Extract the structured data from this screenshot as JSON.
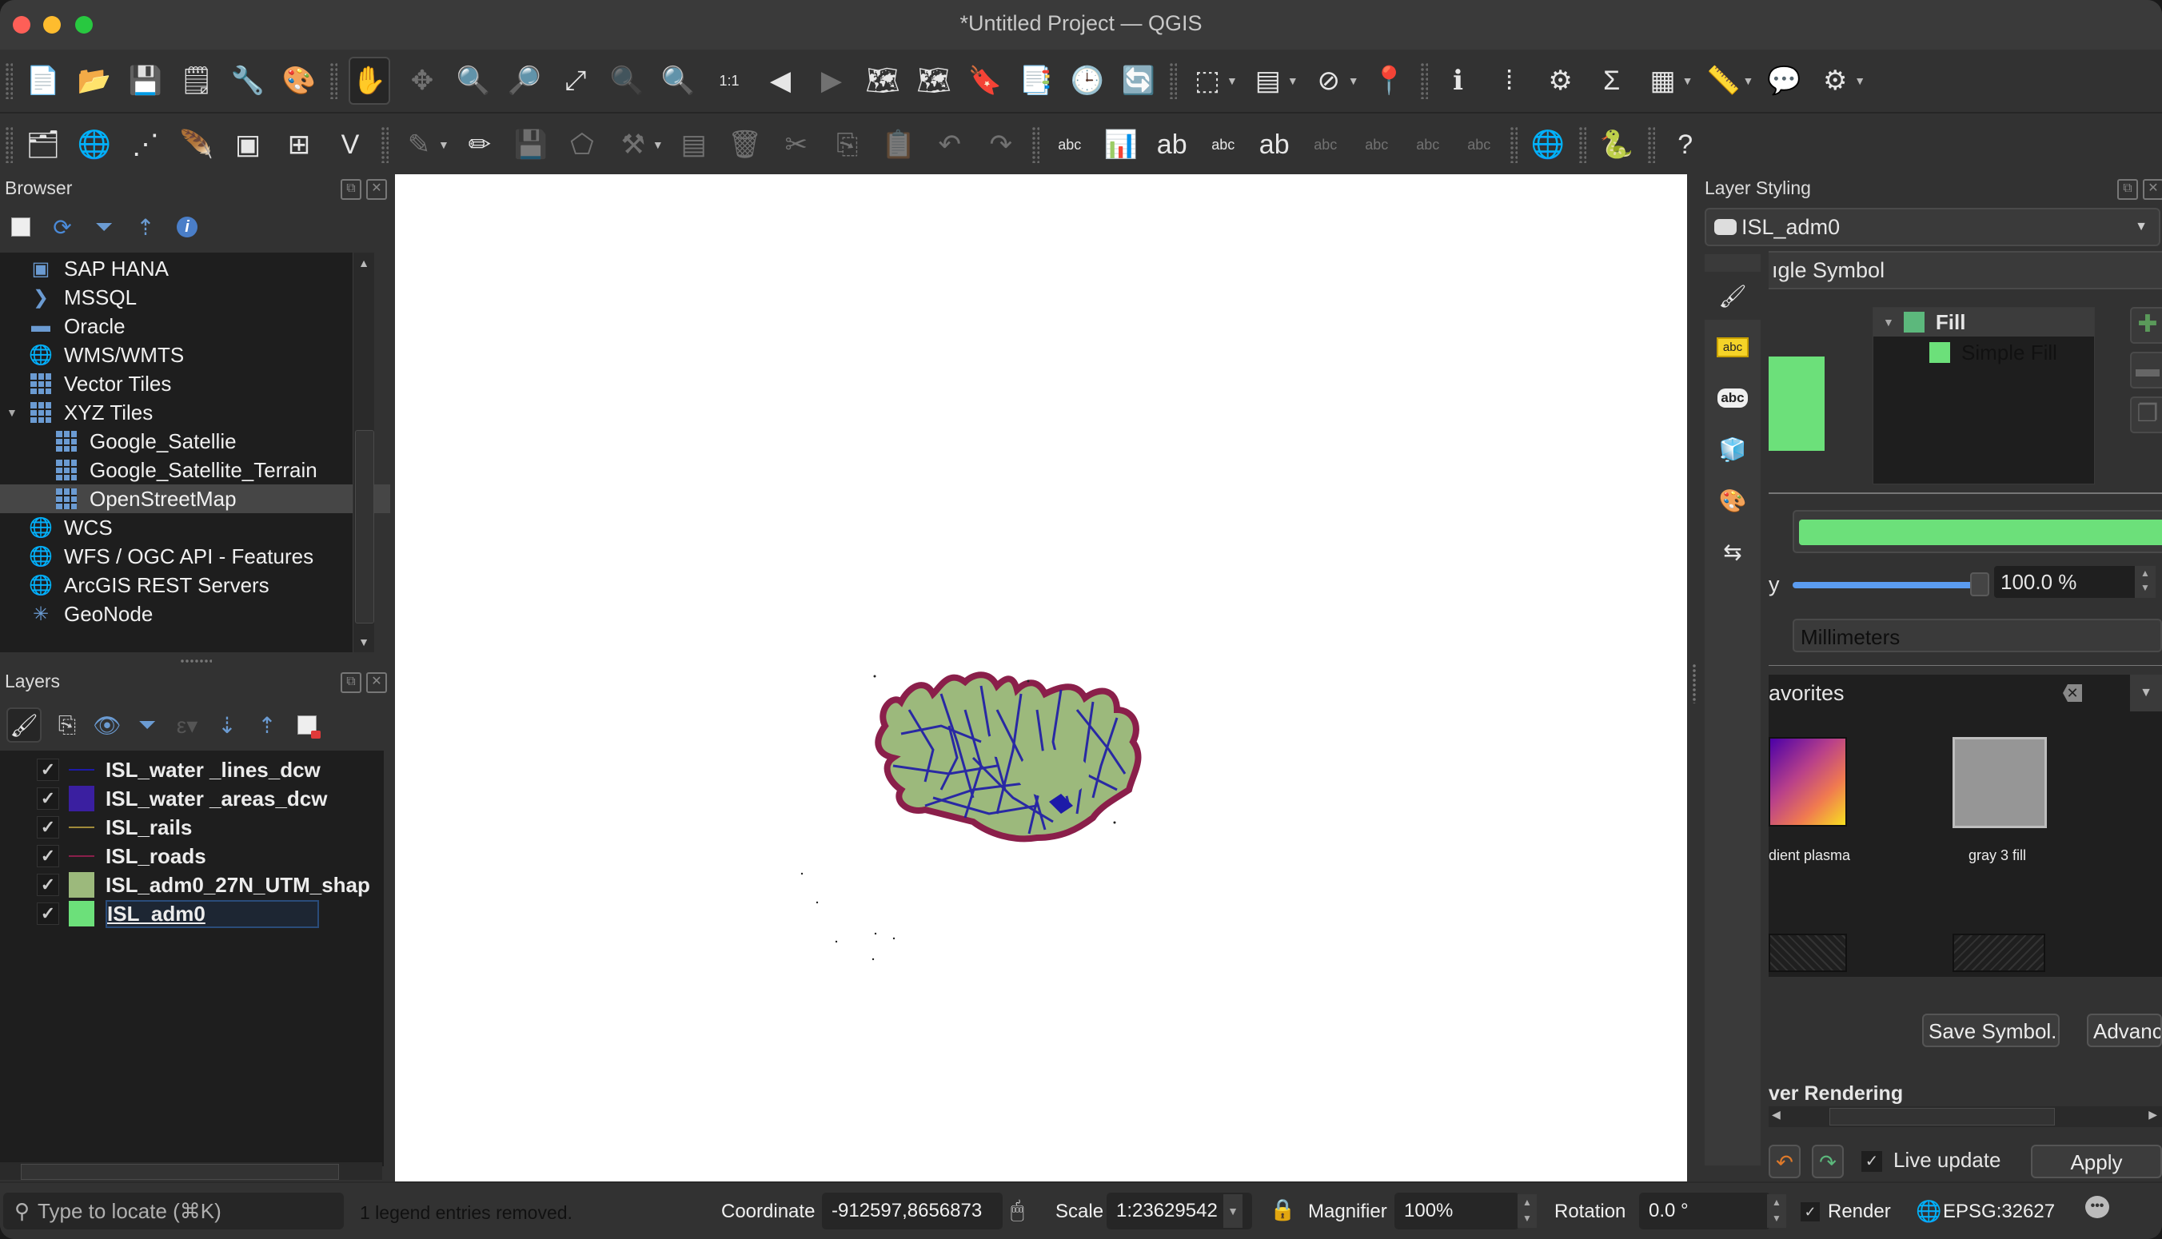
{
  "window": {
    "title": "*Untitled Project — QGIS"
  },
  "toolbar_top": {
    "buttons": [
      {
        "name": "new-project",
        "glyph": "📄"
      },
      {
        "name": "open-project",
        "glyph": "📂"
      },
      {
        "name": "save-project",
        "glyph": "💾"
      },
      {
        "name": "new-print-layout",
        "glyph": "🗒"
      },
      {
        "name": "layout-manager",
        "glyph": "🔧"
      },
      {
        "name": "style-manager",
        "glyph": "🎨"
      },
      {
        "name": "pan-map",
        "glyph": "✋"
      },
      {
        "name": "pan-to-selection",
        "glyph": "✥"
      },
      {
        "name": "zoom-in",
        "glyph": "🔍"
      },
      {
        "name": "zoom-out",
        "glyph": "🔎"
      },
      {
        "name": "zoom-full",
        "glyph": "⤢"
      },
      {
        "name": "zoom-to-selection",
        "glyph": "🔍"
      },
      {
        "name": "zoom-to-layer",
        "glyph": "🔍"
      },
      {
        "name": "zoom-native",
        "glyph": "1:1"
      },
      {
        "name": "zoom-last",
        "glyph": "◀"
      },
      {
        "name": "zoom-next",
        "glyph": "▶"
      },
      {
        "name": "new-map-view",
        "glyph": "🗺"
      },
      {
        "name": "new-3d-map-view",
        "glyph": "🗺"
      },
      {
        "name": "new-spatial-bookmark",
        "glyph": "🔖"
      },
      {
        "name": "show-bookmarks",
        "glyph": "📑"
      },
      {
        "name": "temporal-controller",
        "glyph": "🕒"
      },
      {
        "name": "refresh",
        "glyph": "🔄"
      },
      {
        "name": "select-features",
        "glyph": "⬚"
      },
      {
        "name": "select-by-attributes",
        "glyph": "▤"
      },
      {
        "name": "deselect-features",
        "glyph": "⊘"
      },
      {
        "name": "select-by-location",
        "glyph": "📍"
      },
      {
        "name": "identify-features",
        "glyph": "ℹ"
      },
      {
        "name": "open-attribute-table",
        "glyph": "⁞"
      },
      {
        "name": "processing-toolbox",
        "glyph": "⚙"
      },
      {
        "name": "statistical-summary",
        "glyph": "Σ"
      },
      {
        "name": "attribute-table",
        "glyph": "▦"
      },
      {
        "name": "measure-line",
        "glyph": "📏"
      },
      {
        "name": "map-tips",
        "glyph": "💬"
      },
      {
        "name": "run-feature-action",
        "glyph": "⚙"
      }
    ]
  },
  "toolbar_second": {
    "buttons": [
      {
        "name": "data-source-manager",
        "glyph": "🗂"
      },
      {
        "name": "new-geopackage-layer",
        "glyph": "🌐"
      },
      {
        "name": "new-shapefile-layer",
        "glyph": "⋰"
      },
      {
        "name": "new-temporary-scratch-layer",
        "glyph": "🪶"
      },
      {
        "name": "new-virtual-layer",
        "glyph": "▣"
      },
      {
        "name": "new-mesh-layer",
        "glyph": "⊞"
      },
      {
        "name": "new-gps-layer",
        "glyph": "V"
      },
      {
        "name": "current-edits",
        "glyph": "✎"
      },
      {
        "name": "toggle-editing",
        "glyph": "✏"
      },
      {
        "name": "save-layer-edits",
        "glyph": "💾"
      },
      {
        "name": "add-polygon-feature",
        "glyph": "⬠"
      },
      {
        "name": "vertex-tool",
        "glyph": "⚒"
      },
      {
        "name": "modify-attributes",
        "glyph": "▤"
      },
      {
        "name": "delete-selected",
        "glyph": "🗑"
      },
      {
        "name": "cut-features",
        "glyph": "✂"
      },
      {
        "name": "copy-features",
        "glyph": "⎘"
      },
      {
        "name": "paste-features",
        "glyph": "📋"
      },
      {
        "name": "undo",
        "glyph": "↶"
      },
      {
        "name": "redo",
        "glyph": "↷"
      },
      {
        "name": "layer-labeling-options",
        "glyph": "abc"
      },
      {
        "name": "layer-diagram-options",
        "glyph": "📊"
      },
      {
        "name": "highlight-pinned-labels",
        "glyph": "ab"
      },
      {
        "name": "toggle-label-display",
        "glyph": "abc"
      },
      {
        "name": "pin-unpin-labels",
        "glyph": "ab"
      },
      {
        "name": "show-hide-labels",
        "glyph": "abc"
      },
      {
        "name": "move-label",
        "glyph": "abc"
      },
      {
        "name": "rotate-label",
        "glyph": "abc"
      },
      {
        "name": "change-label",
        "glyph": "abc"
      },
      {
        "name": "metasearch",
        "glyph": "🌐"
      },
      {
        "name": "python-console",
        "glyph": "🐍"
      },
      {
        "name": "help-contents",
        "glyph": "?"
      }
    ]
  },
  "browser": {
    "title": "Browser",
    "items": [
      {
        "label": "SAP HANA",
        "icon": "sap-hana-icon",
        "indent": 0
      },
      {
        "label": "MSSQL",
        "icon": "mssql-icon",
        "indent": 0
      },
      {
        "label": "Oracle",
        "icon": "oracle-icon",
        "indent": 0
      },
      {
        "label": "WMS/WMTS",
        "icon": "wms-icon",
        "indent": 0
      },
      {
        "label": "Vector Tiles",
        "icon": "vector-tiles-icon",
        "indent": 0
      },
      {
        "label": "XYZ Tiles",
        "icon": "xyz-tiles-icon",
        "indent": 0,
        "expanded": true
      },
      {
        "label": "Google_Satellie",
        "icon": "xyz-layer-icon",
        "indent": 1
      },
      {
        "label": "Google_Satellite_Terrain",
        "icon": "xyz-layer-icon",
        "indent": 1
      },
      {
        "label": "OpenStreetMap",
        "icon": "xyz-layer-icon",
        "indent": 1,
        "selected": true
      },
      {
        "label": "WCS",
        "icon": "wcs-icon",
        "indent": 0
      },
      {
        "label": "WFS / OGC API - Features",
        "icon": "wfs-icon",
        "indent": 0
      },
      {
        "label": "ArcGIS REST Servers",
        "icon": "arcgis-icon",
        "indent": 0
      },
      {
        "label": "GeoNode",
        "icon": "geonode-icon",
        "indent": 0
      }
    ]
  },
  "layers": {
    "title": "Layers",
    "items": [
      {
        "name": "ISL_water _lines_dcw",
        "checked": true,
        "symbol": "line",
        "color": "#1d1aa8"
      },
      {
        "name": "ISL_water _areas_dcw",
        "checked": true,
        "symbol": "fill",
        "color": "#3a1fa0"
      },
      {
        "name": "ISL_rails",
        "checked": true,
        "symbol": "line",
        "color": "#a08a3a"
      },
      {
        "name": "ISL_roads",
        "checked": true,
        "symbol": "line",
        "color": "#8a1f4a"
      },
      {
        "name": "ISL_adm0_27N_UTM_shap",
        "checked": true,
        "symbol": "fill",
        "color": "#9cb97c"
      },
      {
        "name": "ISL_adm0",
        "checked": true,
        "symbol": "fill",
        "color": "#6ce07a",
        "current": true
      }
    ]
  },
  "styling": {
    "title": "Layer Styling",
    "layer": "ISL_adm0",
    "renderer": "ıgle Symbol",
    "symbol_tree": {
      "root": "Fill",
      "child": "Simple Fill",
      "root_color": "#5cb87c",
      "child_color": "#6ce07a"
    },
    "fill_color": "#6ce07a",
    "opacity_label": "y",
    "opacity_value": "100.0 %",
    "opacity_fraction": 1.0,
    "unit": "Millimeters",
    "favorites_label": "avorites",
    "favorites": [
      {
        "label": "dient   plasma",
        "kind": "gradient"
      },
      {
        "label": "gray 3 fill",
        "kind": "gray"
      }
    ],
    "save_symbol_label": "Save Symbol...",
    "advanced_label": "Advanc",
    "section_title": "ver Rendering",
    "live_update_label": "Live update",
    "live_update_checked": true,
    "apply_label": "Apply"
  },
  "statusbar": {
    "locator_placeholder": "Type to locate (⌘K)",
    "message": "1 legend entries removed.",
    "coordinate_label": "Coordinate",
    "coordinate_value": "-912597,8656873",
    "scale_label": "Scale",
    "scale_value": "1:23629542",
    "magnifier_label": "Magnifier",
    "magnifier_value": "100%",
    "rotation_label": "Rotation",
    "rotation_value": "0.0 °",
    "render_label": "Render",
    "render_checked": true,
    "crs": "EPSG:32627"
  }
}
